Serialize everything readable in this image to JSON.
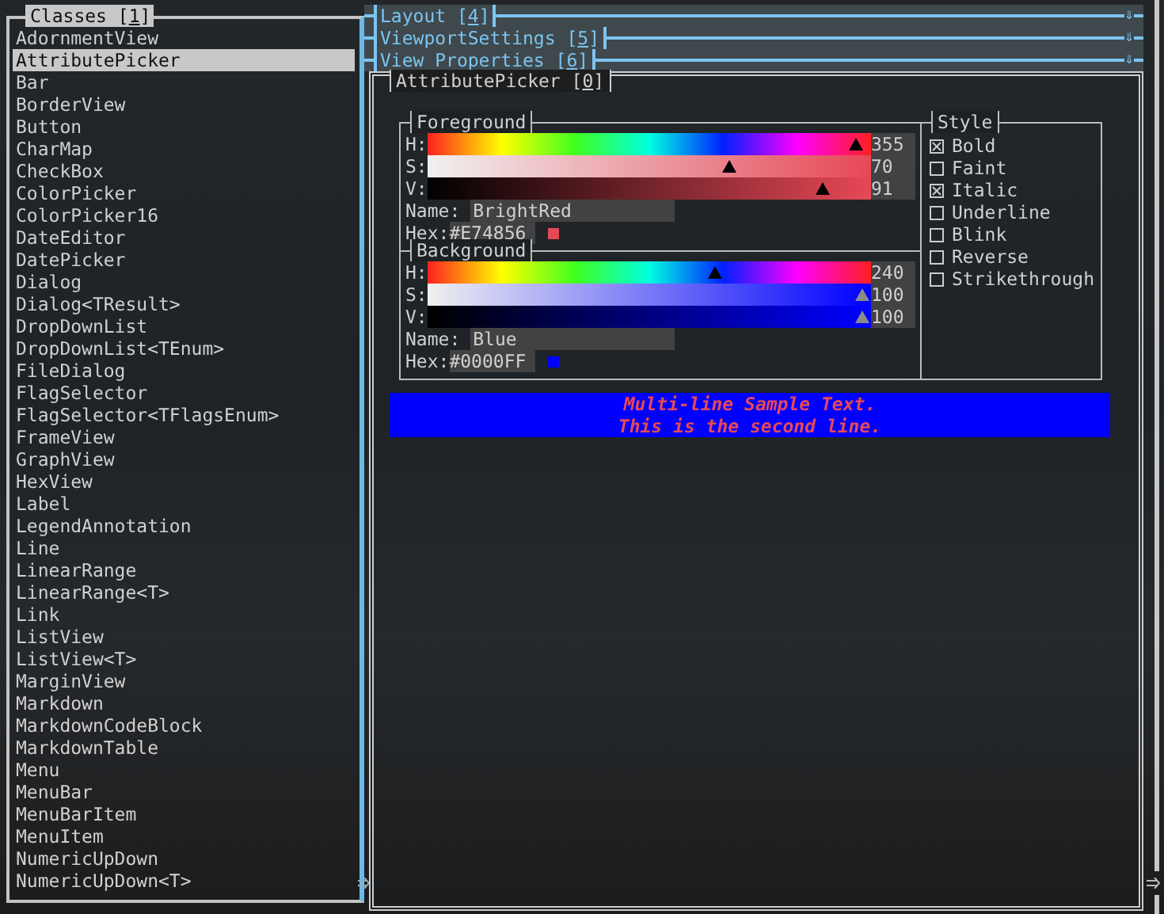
{
  "classes": {
    "title_before": "Classes [",
    "hotkey": "1",
    "title_after": "]",
    "items": [
      {
        "label": "AdornmentView",
        "selected": false
      },
      {
        "label": "AttributePicker",
        "selected": true
      },
      {
        "label": "Bar",
        "selected": false
      },
      {
        "label": "BorderView",
        "selected": false
      },
      {
        "label": "Button",
        "selected": false
      },
      {
        "label": "CharMap",
        "selected": false
      },
      {
        "label": "CheckBox",
        "selected": false
      },
      {
        "label": "ColorPicker",
        "selected": false
      },
      {
        "label": "ColorPicker16",
        "selected": false
      },
      {
        "label": "DateEditor",
        "selected": false
      },
      {
        "label": "DatePicker",
        "selected": false
      },
      {
        "label": "Dialog",
        "selected": false
      },
      {
        "label": "Dialog<TResult>",
        "selected": false
      },
      {
        "label": "DropDownList",
        "selected": false
      },
      {
        "label": "DropDownList<TEnum>",
        "selected": false
      },
      {
        "label": "FileDialog",
        "selected": false
      },
      {
        "label": "FlagSelector",
        "selected": false
      },
      {
        "label": "FlagSelector<TFlagsEnum>",
        "selected": false
      },
      {
        "label": "FrameView",
        "selected": false
      },
      {
        "label": "GraphView",
        "selected": false
      },
      {
        "label": "HexView",
        "selected": false
      },
      {
        "label": "Label",
        "selected": false
      },
      {
        "label": "LegendAnnotation",
        "selected": false
      },
      {
        "label": "Line",
        "selected": false
      },
      {
        "label": "LinearRange",
        "selected": false
      },
      {
        "label": "LinearRange<T>",
        "selected": false
      },
      {
        "label": "Link",
        "selected": false
      },
      {
        "label": "ListView",
        "selected": false
      },
      {
        "label": "ListView<T>",
        "selected": false
      },
      {
        "label": "MarginView",
        "selected": false
      },
      {
        "label": "Markdown",
        "selected": false
      },
      {
        "label": "MarkdownCodeBlock",
        "selected": false
      },
      {
        "label": "MarkdownTable",
        "selected": false
      },
      {
        "label": "Menu",
        "selected": false
      },
      {
        "label": "MenuBar",
        "selected": false
      },
      {
        "label": "MenuBarItem",
        "selected": false
      },
      {
        "label": "MenuItem",
        "selected": false
      },
      {
        "label": "NumericUpDown",
        "selected": false
      },
      {
        "label": "NumericUpDown<T>",
        "selected": false
      }
    ]
  },
  "tabs": [
    {
      "title_before": "Layout [",
      "hotkey": "4",
      "title_after": "]",
      "glyph": "⇓"
    },
    {
      "title_before": "ViewportSettings [",
      "hotkey": "5",
      "title_after": "]",
      "glyph": "⇓"
    },
    {
      "title_before": "View Properties [",
      "hotkey": "6",
      "title_after": "]",
      "glyph": "⇓"
    }
  ],
  "picker": {
    "title_before": "AttributePicker [",
    "hotkey": "0",
    "title_after": "]",
    "colors": [
      {
        "title": "Foreground",
        "color": "#e74856",
        "sliders": [
          {
            "kind": "hue",
            "label": "H:",
            "value": "355",
            "level": 0.986
          },
          {
            "kind": "saturation",
            "label": "S:",
            "value": "70",
            "level": 0.7
          },
          {
            "kind": "value",
            "label": "V:",
            "value": "91",
            "level": 0.91
          }
        ],
        "name_label": "Name:",
        "name": "BrightRed",
        "hex_label": "Hex:",
        "hex": "#E74856"
      },
      {
        "title": "Background",
        "color": "#0000ff",
        "sliders": [
          {
            "kind": "hue",
            "label": "H:",
            "value": "240",
            "level": 0.667
          },
          {
            "kind": "saturation",
            "label": "S:",
            "value": "100",
            "level": 1
          },
          {
            "kind": "value",
            "label": "V:",
            "value": "100",
            "level": 1
          }
        ],
        "name_label": "Name:",
        "name": "Blue",
        "hex_label": "Hex:",
        "hex": "#0000FF"
      }
    ],
    "style": {
      "title": "Style",
      "options": [
        {
          "label": "Bold",
          "checked": true
        },
        {
          "label": "Faint",
          "checked": false
        },
        {
          "label": "Italic",
          "checked": true
        },
        {
          "label": "Underline",
          "checked": false
        },
        {
          "label": "Blink",
          "checked": false
        },
        {
          "label": "Reverse",
          "checked": false
        },
        {
          "label": "Strikethrough",
          "checked": false
        }
      ]
    },
    "sample_lines": [
      "Multi-line Sample Text.",
      "This is the second line."
    ]
  }
}
